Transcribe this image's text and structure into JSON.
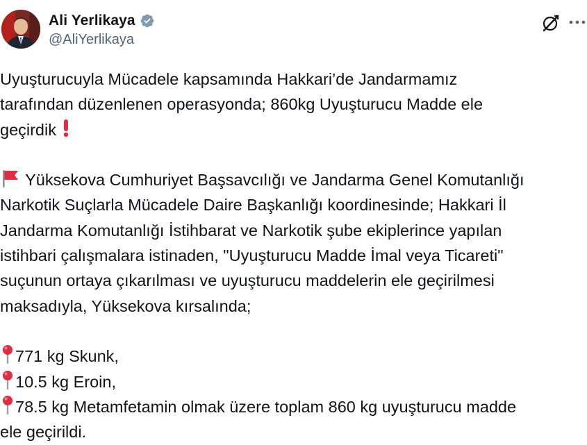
{
  "author": {
    "display_name": "Ali Yerlikaya",
    "handle": "@AliYerlikaya",
    "verified": true,
    "avatar_icon": "profile-photo"
  },
  "actions": {
    "grok_icon": "grok-slash-icon",
    "more_icon": "more-dots-icon"
  },
  "tweet": {
    "para1": [
      "Uyuşturucuyla Mücadele kapsamında Hakkari’de Jandarmamız",
      "tarafından düzenlenen operasyonda; 860kg Uyuşturucu Madde ele",
      "geçirdik"
    ],
    "para2": [
      "Yüksekova Cumhuriyet Başsavcılığı ve Jandarma Genel Komutanlığı",
      "Narkotik Suçlarla Mücadele Daire Başkanlığı koordinesinde; Hakkari İl",
      "Jandarma Komutanlığı İstihbarat ve Narkotik şube ekiplerince yapılan",
      "istihbari çalışmalara istinaden, \"Uyuşturucu Madde İmal veya Ticareti\"",
      "suçunun ortaya çıkarılması ve uyuşturucu maddelerin ele geçirilmesi",
      "maksadıyla, Yüksekova kırsalında;"
    ],
    "items": [
      "771 kg Skunk,",
      "10.5 kg Eroin,",
      "78.5 kg Metamfetamin olmak üzere toplam 860 kg uyuşturucu madde"
    ],
    "last_line": "ele geçirildi."
  },
  "colors": {
    "text": "#0f1419",
    "secondary": "#536471",
    "verified": "#829aab",
    "emoji_red": "#dd2e44"
  }
}
